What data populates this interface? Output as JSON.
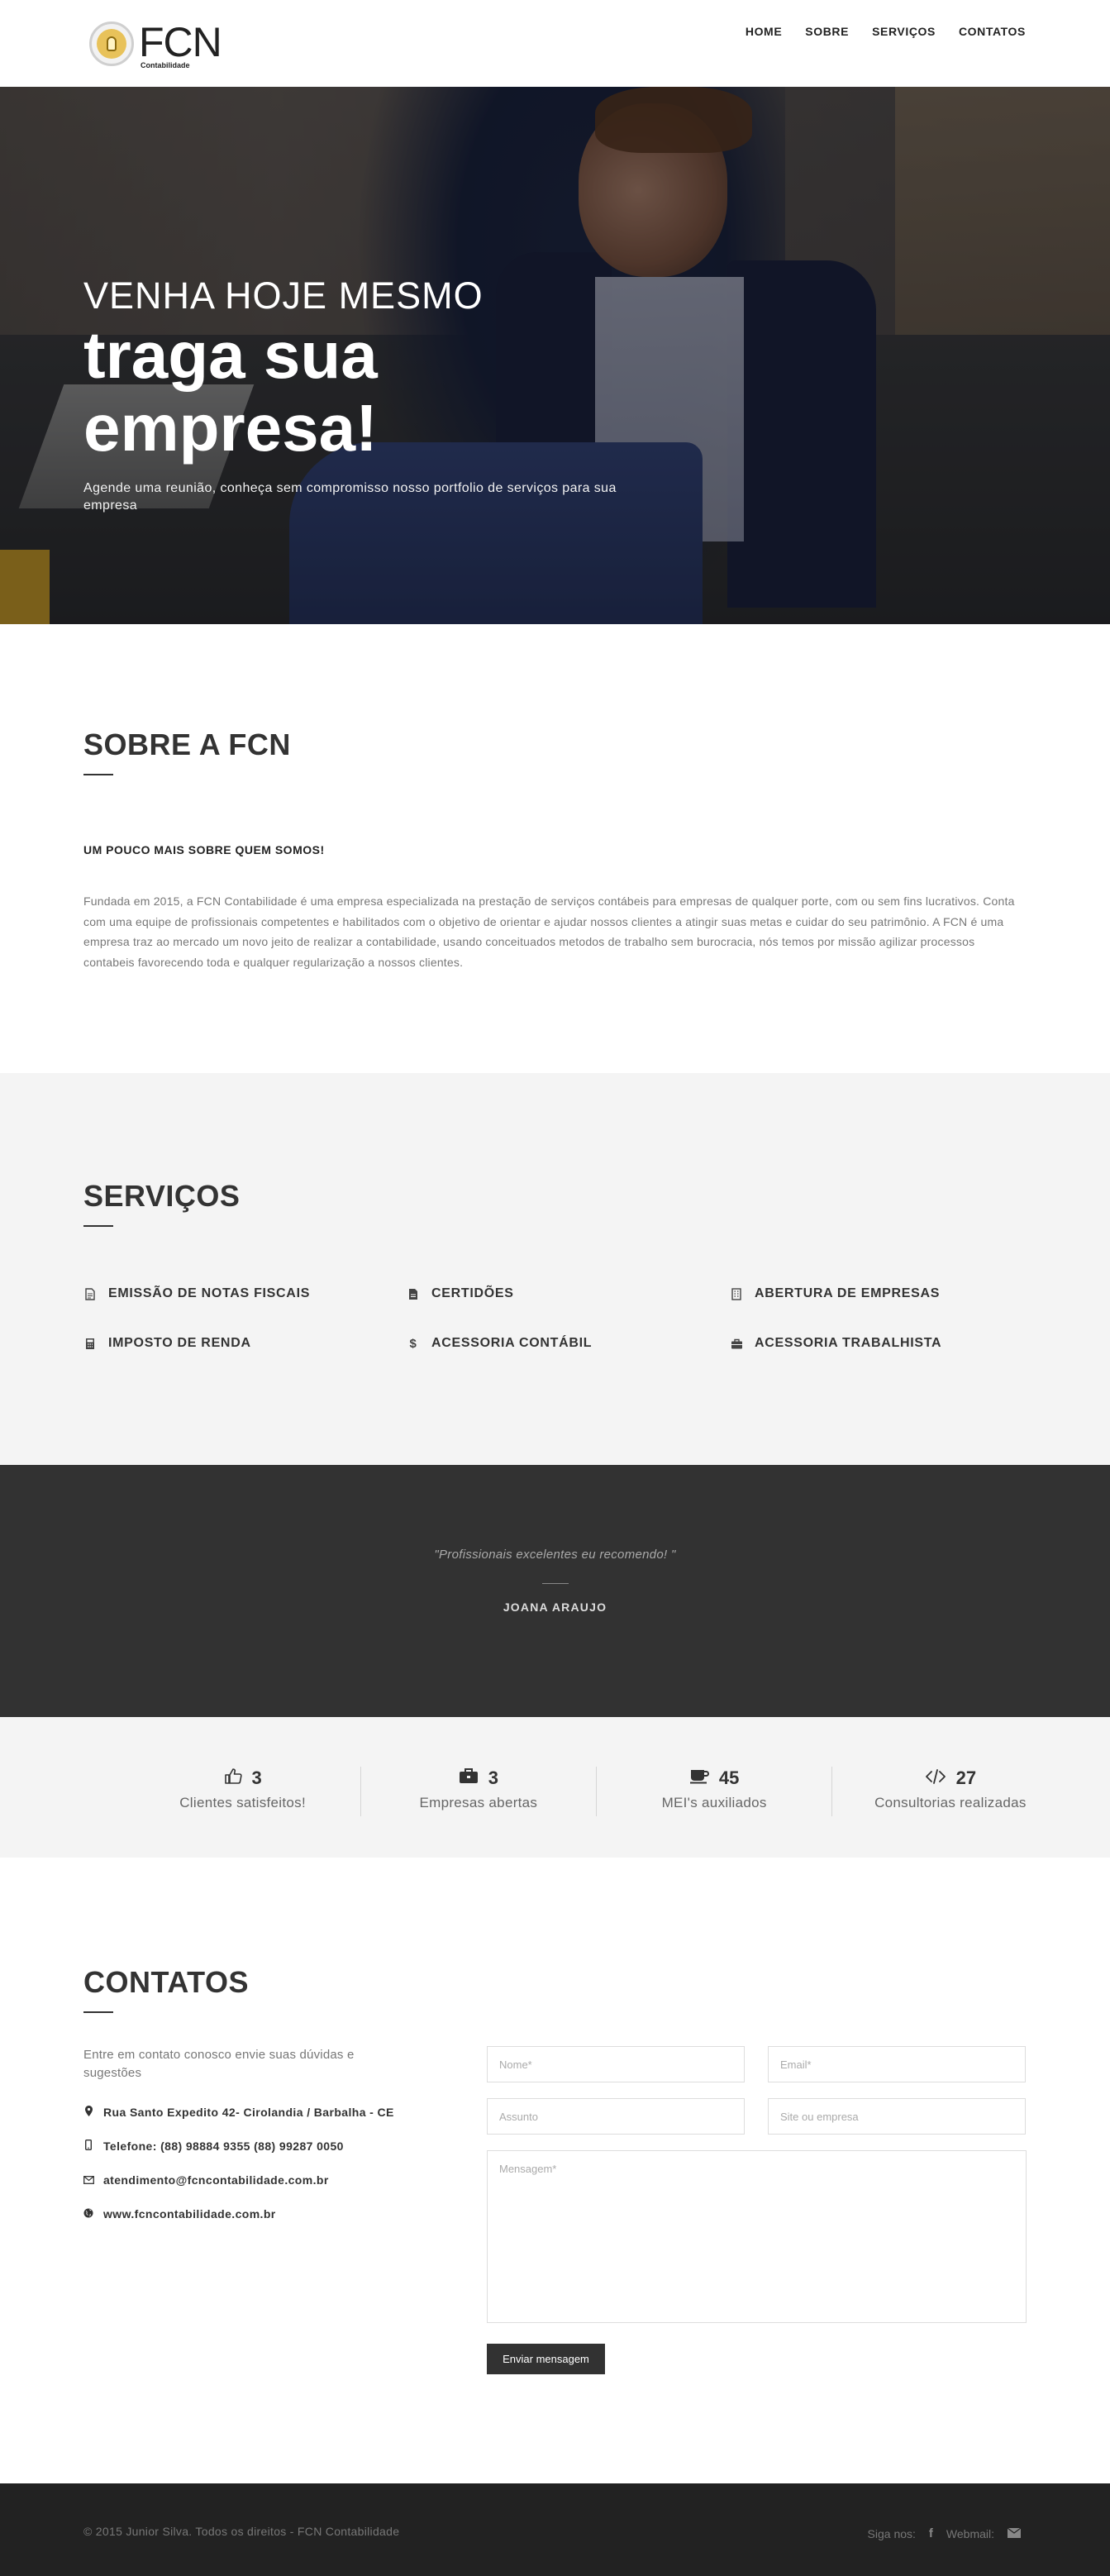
{
  "nav": {
    "logo_text": "FCN",
    "logo_sub": "Contabilidade",
    "items": [
      {
        "label": "HOME"
      },
      {
        "label": "SOBRE"
      },
      {
        "label": "SERVIÇOS"
      },
      {
        "label": "CONTATOS"
      }
    ]
  },
  "hero": {
    "kicker": "VENHA HOJE MESMO",
    "title": "traga sua empresa!",
    "subtitle": "Agende uma reunião, conheça sem compromisso nosso portfolio de serviços para sua empresa"
  },
  "sobre": {
    "title": "SOBRE A FCN",
    "subtitle": "UM POUCO MAIS SOBRE QUEM SOMOS!",
    "body": "Fundada em 2015, a FCN Contabilidade é uma empresa especializada na prestação de serviços contábeis para empresas de qualquer porte, com ou sem fins lucrativos. Conta com uma equipe de profissionais competentes e habilitados com o objetivo de orientar e ajudar nossos clientes a atingir suas metas e cuidar do seu patrimônio. A FCN é uma empresa traz ao mercado um novo jeito de realizar a contabilidade, usando conceituados metodos de trabalho sem burocracia, nós temos por missão agilizar processos contabeis favorecendo toda e qualquer regularização a nossos clientes."
  },
  "servicos": {
    "title": "SERVIÇOS",
    "items": [
      {
        "label": "EMISSÃO DE NOTAS FISCAIS",
        "icon": "document-icon"
      },
      {
        "label": "CERTIDÕES",
        "icon": "file-icon"
      },
      {
        "label": "ABERTURA DE EMPRESAS",
        "icon": "building-icon"
      },
      {
        "label": "IMPOSTO DE RENDA",
        "icon": "calculator-icon"
      },
      {
        "label": "ACESSORIA CONTÁBIL",
        "icon": "dollar-icon"
      },
      {
        "label": "ACESSORIA TRABALHISTA",
        "icon": "briefcase-icon"
      }
    ]
  },
  "testimonial": {
    "quote": "\"Profissionais excelentes eu recomendo! \"",
    "author": "JOANA ARAUJO"
  },
  "stats": [
    {
      "icon": "thumbs-up-icon",
      "value": "3",
      "label": "Clientes satisfeitos!"
    },
    {
      "icon": "briefcase-icon",
      "value": "3",
      "label": "Empresas abertas"
    },
    {
      "icon": "coffee-icon",
      "value": "45",
      "label": "MEI's auxiliados"
    },
    {
      "icon": "code-icon",
      "value": "27",
      "label": "Consultorias realizadas"
    }
  ],
  "contatos": {
    "title": "CONTATOS",
    "intro": "Entre em contato conosco envie suas dúvidas e sugestões",
    "address": "Rua Santo Expedito 42- Cirolandia / Barbalha - CE",
    "phone": "Telefone: (88) 98884 9355 (88) 99287 0050",
    "email": "atendimento@fcncontabilidade.com.br",
    "website": "www.fcncontabilidade.com.br",
    "form": {
      "name_placeholder": "Nome*",
      "email_placeholder": "Email*",
      "subject_placeholder": "Assunto",
      "site_placeholder": "Site ou empresa",
      "message_placeholder": "Mensagem*",
      "submit_label": "Enviar mensagem"
    }
  },
  "footer": {
    "copyright": "© 2015 Junior Silva. Todos os direitos - FCN Contabilidade",
    "follow_label": "Siga nos:",
    "facebook_glyph": "f",
    "webmail_label": "Webmail:"
  },
  "colors": {
    "dark_section": "#323232",
    "light_section": "#f4f4f4",
    "footer": "#222222"
  }
}
